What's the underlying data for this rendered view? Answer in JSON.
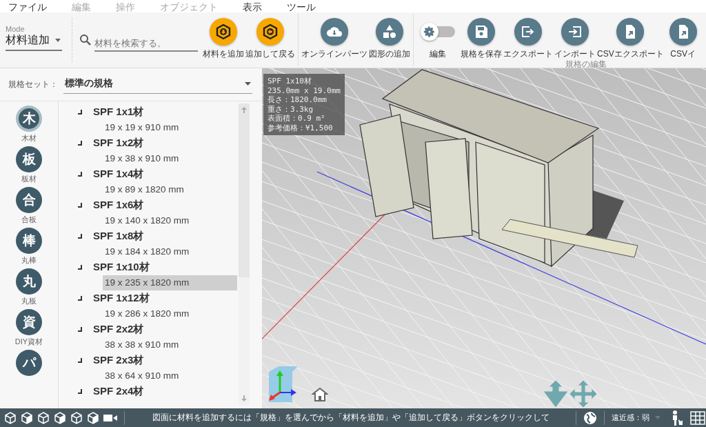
{
  "menu": [
    {
      "label": "ファイル",
      "disabled": false
    },
    {
      "label": "編集",
      "disabled": true
    },
    {
      "label": "操作",
      "disabled": true
    },
    {
      "label": "オブジェクト",
      "disabled": true
    },
    {
      "label": "表示",
      "disabled": false
    },
    {
      "label": "ツール",
      "disabled": false
    }
  ],
  "mode": {
    "label": "Mode",
    "value": "材料追加"
  },
  "search": {
    "placeholder": "材料を検索する。"
  },
  "toolbar": [
    {
      "buttons": [
        {
          "kind": "accent",
          "label": "材料を追加"
        },
        {
          "kind": "accent",
          "label": "追加して戻る"
        }
      ]
    },
    {
      "buttons": [
        {
          "kind": "plain",
          "label": "オンラインパーツ"
        },
        {
          "kind": "plain",
          "label": "図形の追加"
        }
      ]
    },
    {
      "caption": "規格の編集",
      "buttons": [
        {
          "kind": "toggle",
          "label": "編集",
          "on": false
        },
        {
          "kind": "plain",
          "label": "規格を保存"
        },
        {
          "kind": "plain",
          "label": "エクスポート"
        },
        {
          "kind": "plain",
          "label": "インポート"
        },
        {
          "kind": "plain",
          "label": "CSVエクスポート"
        },
        {
          "kind": "plain",
          "label": "CSVイ"
        }
      ]
    }
  ],
  "spec_set": {
    "label": "規格セット：",
    "value": "標準の規格"
  },
  "categories": [
    {
      "glyph": "木",
      "label": "木材",
      "selected": true
    },
    {
      "glyph": "板",
      "label": "板材",
      "selected": false
    },
    {
      "glyph": "合",
      "label": "合板",
      "selected": false
    },
    {
      "glyph": "棒",
      "label": "丸棒",
      "selected": false
    },
    {
      "glyph": "丸",
      "label": "丸板",
      "selected": false
    },
    {
      "glyph": "資",
      "label": "DIY資材",
      "selected": false
    },
    {
      "glyph": "パ",
      "selected": false
    }
  ],
  "materials": [
    {
      "name": "SPF 1x1材",
      "size": "19 x 19 x 910 mm",
      "selected": false
    },
    {
      "name": "SPF 1x2材",
      "size": "19 x 38 x 910 mm",
      "selected": false
    },
    {
      "name": "SPF 1x4材",
      "size": "19 x 89 x 1820 mm",
      "selected": false
    },
    {
      "name": "SPF 1x6材",
      "size": "19 x 140 x 1820 mm",
      "selected": false
    },
    {
      "name": "SPF 1x8材",
      "size": "19 x 184 x 1820 mm",
      "selected": false
    },
    {
      "name": "SPF 1x10材",
      "size": "19 x 235 x 1820 mm",
      "selected": true
    },
    {
      "name": "SPF 1x12材",
      "size": "19 x 286 x 1820 mm",
      "selected": false
    },
    {
      "name": "SPF 2x2材",
      "size": "38 x 38 x 910 mm",
      "selected": false
    },
    {
      "name": "SPF 2x3材",
      "size": "38 x 64 x 910 mm",
      "selected": false
    },
    {
      "name": "SPF 2x4材"
    }
  ],
  "info": [
    "SPF 1x10材",
    "235.0mm x 19.0mm",
    "長さ：1820.0mm",
    "重さ：3.3kg",
    "表面積：0.9 m²",
    "参考価格：¥1,500"
  ],
  "status": {
    "message": "図面に材料を追加するには「規格」を選んでから「材料を追加」や「追加して戻る」ボタンをクリックして",
    "perspective": "遠近感：弱"
  }
}
